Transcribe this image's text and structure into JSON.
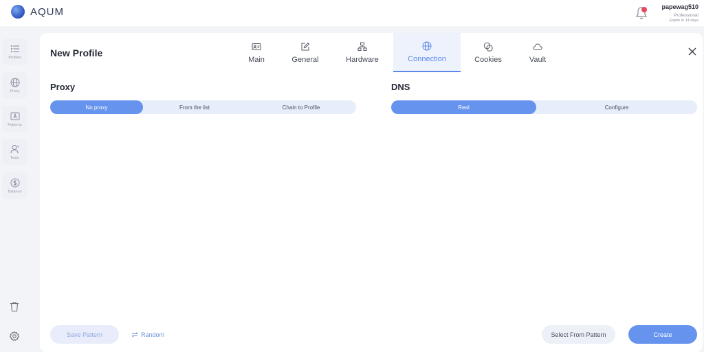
{
  "app": {
    "name": "AQUM"
  },
  "user": {
    "name": "papewag510",
    "plan": "Professional",
    "expire": "Expire in 14 days"
  },
  "sidebar": {
    "items": [
      {
        "label": "Profiles",
        "icon": "list-icon"
      },
      {
        "label": "Proxy",
        "icon": "globe-icon"
      },
      {
        "label": "Patterns",
        "icon": "pattern-icon"
      },
      {
        "label": "Team",
        "icon": "team-icon"
      },
      {
        "label": "Balance",
        "icon": "dollar-icon"
      }
    ],
    "bottom": [
      "trash-icon",
      "gear-icon"
    ]
  },
  "panel": {
    "title": "New Profile",
    "tabs": [
      {
        "label": "Main",
        "icon": "id-card-icon"
      },
      {
        "label": "General",
        "icon": "edit-icon"
      },
      {
        "label": "Hardware",
        "icon": "hardware-icon"
      },
      {
        "label": "Connection",
        "icon": "globe-icon",
        "active": true
      },
      {
        "label": "Cookies",
        "icon": "cookies-icon"
      },
      {
        "label": "Vault",
        "icon": "cloud-icon"
      }
    ]
  },
  "proxy": {
    "title": "Proxy",
    "options": [
      "No proxy",
      "From the list",
      "Chain to Profile"
    ],
    "selected": "No proxy"
  },
  "dns": {
    "title": "DNS",
    "options": [
      "Real",
      "Configure"
    ],
    "selected": "Real"
  },
  "footer": {
    "save_pattern": "Save Pattern",
    "random": "Random",
    "select_from_pattern": "Select From Pattern",
    "create": "Create"
  },
  "colors": {
    "accent": "#6593ee",
    "notification": "#e64a5a"
  }
}
